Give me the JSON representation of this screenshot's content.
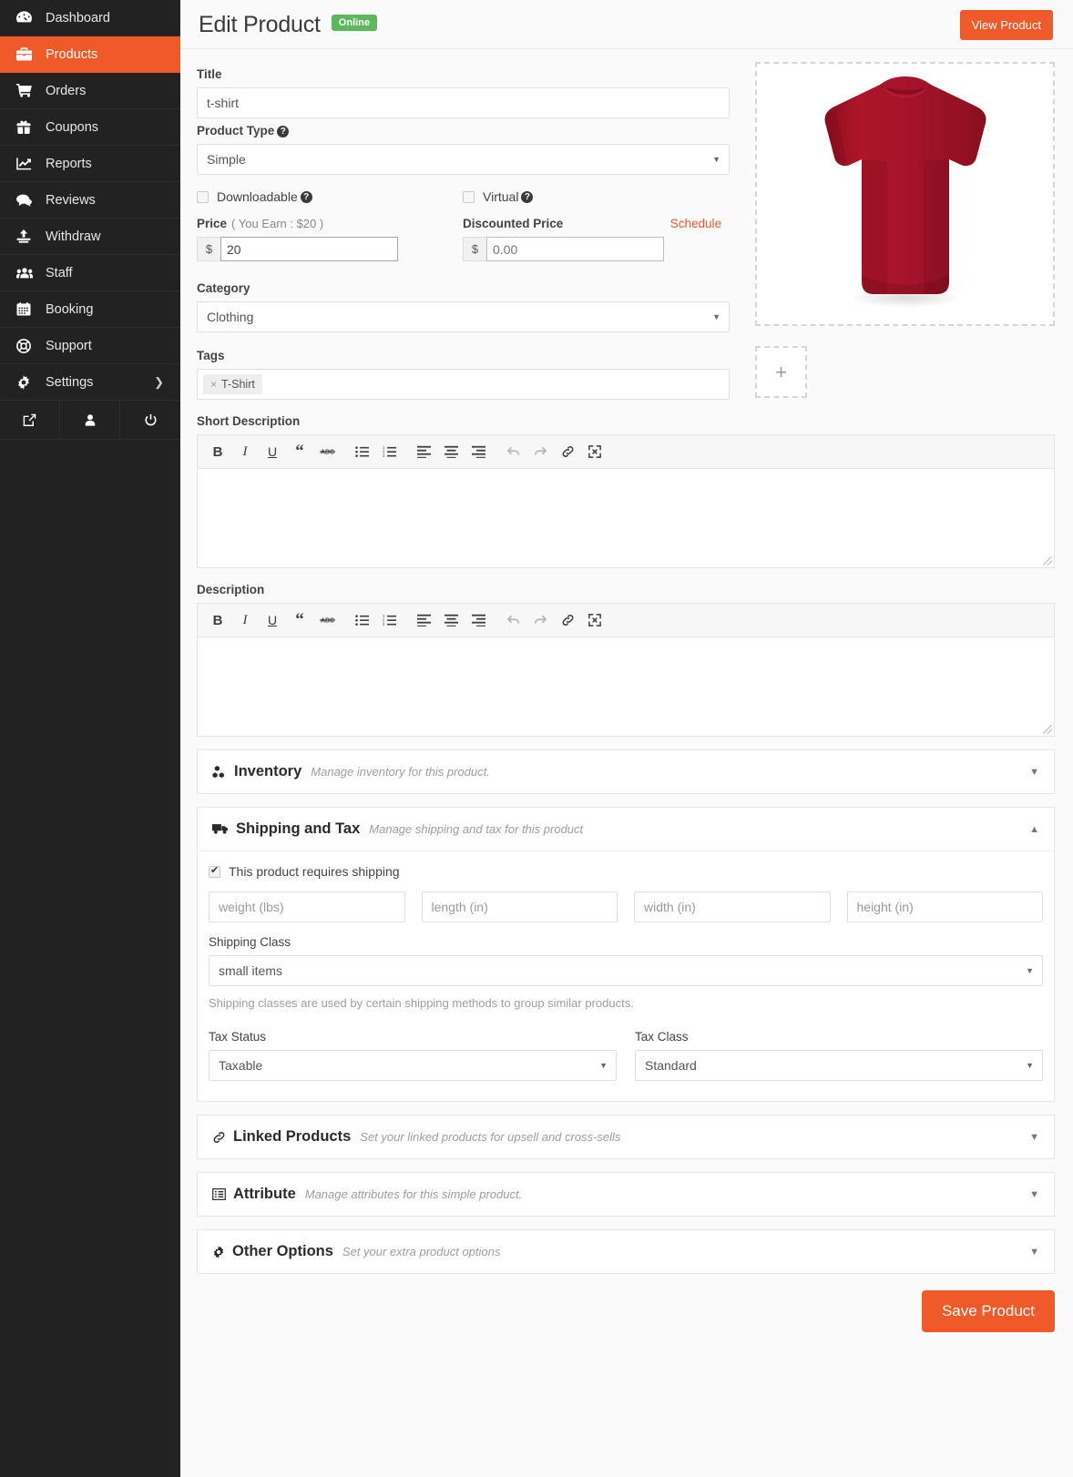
{
  "sidebar": {
    "items": [
      {
        "label": "Dashboard",
        "icon": "dashboard-icon",
        "active": false
      },
      {
        "label": "Products",
        "icon": "products-icon",
        "active": true
      },
      {
        "label": "Orders",
        "icon": "orders-icon",
        "active": false
      },
      {
        "label": "Coupons",
        "icon": "coupons-icon",
        "active": false
      },
      {
        "label": "Reports",
        "icon": "reports-icon",
        "active": false
      },
      {
        "label": "Reviews",
        "icon": "reviews-icon",
        "active": false
      },
      {
        "label": "Withdraw",
        "icon": "withdraw-icon",
        "active": false
      },
      {
        "label": "Staff",
        "icon": "staff-icon",
        "active": false
      },
      {
        "label": "Booking",
        "icon": "booking-icon",
        "active": false
      },
      {
        "label": "Support",
        "icon": "support-icon",
        "active": false
      },
      {
        "label": "Settings",
        "icon": "settings-icon",
        "active": false,
        "has_submenu": true
      }
    ],
    "footer_icons": [
      "external-link-icon",
      "user-icon",
      "power-icon"
    ]
  },
  "header": {
    "title": "Edit Product",
    "status_badge": "Online",
    "view_product_label": "View Product"
  },
  "form": {
    "title_label": "Title",
    "title_value": "t-shirt",
    "product_type_label": "Product Type",
    "product_type_value": "Simple",
    "downloadable_label": "Downloadable",
    "downloadable_checked": false,
    "virtual_label": "Virtual",
    "virtual_checked": false,
    "price_label": "Price",
    "price_earn_note": "( You Earn : $20 )",
    "price_currency": "$",
    "price_value": "20",
    "discounted_label": "Discounted Price",
    "discounted_currency": "$",
    "discounted_placeholder": "0.00",
    "schedule_label": "Schedule",
    "category_label": "Category",
    "category_value": "Clothing",
    "tags_label": "Tags",
    "tags": [
      {
        "remove": "×",
        "label": "T-Shirt"
      }
    ]
  },
  "media": {
    "dropzone_name": "product-image-dropzone",
    "add_image_glyph": "+",
    "image_alt": "red t-shirt product photo"
  },
  "editors": [
    {
      "label": "Short Description",
      "name": "short-description",
      "content": "",
      "toolbar": [
        {
          "name": "bold-icon",
          "glyph": "B"
        },
        {
          "name": "italic-icon",
          "glyph": "I"
        },
        {
          "name": "underline-icon",
          "glyph": "U"
        },
        {
          "name": "blockquote-icon",
          "glyph": "“"
        },
        {
          "name": "strikethrough-icon",
          "glyph": "ABC"
        },
        {
          "name": "bullet-list-icon",
          "glyph": ""
        },
        {
          "name": "numbered-list-icon",
          "glyph": ""
        },
        {
          "name": "align-left-icon",
          "glyph": ""
        },
        {
          "name": "align-center-icon",
          "glyph": ""
        },
        {
          "name": "align-right-icon",
          "glyph": ""
        },
        {
          "name": "undo-icon",
          "glyph": ""
        },
        {
          "name": "redo-icon",
          "glyph": ""
        },
        {
          "name": "link-icon",
          "glyph": ""
        },
        {
          "name": "fullscreen-icon",
          "glyph": ""
        }
      ]
    },
    {
      "label": "Description",
      "name": "description",
      "content": "",
      "toolbar": [
        {
          "name": "bold-icon",
          "glyph": "B"
        },
        {
          "name": "italic-icon",
          "glyph": "I"
        },
        {
          "name": "underline-icon",
          "glyph": "U"
        },
        {
          "name": "blockquote-icon",
          "glyph": "“"
        },
        {
          "name": "strikethrough-icon",
          "glyph": "ABC"
        },
        {
          "name": "bullet-list-icon",
          "glyph": ""
        },
        {
          "name": "numbered-list-icon",
          "glyph": ""
        },
        {
          "name": "align-left-icon",
          "glyph": ""
        },
        {
          "name": "align-center-icon",
          "glyph": ""
        },
        {
          "name": "align-right-icon",
          "glyph": ""
        },
        {
          "name": "undo-icon",
          "glyph": ""
        },
        {
          "name": "redo-icon",
          "glyph": ""
        },
        {
          "name": "link-icon",
          "glyph": ""
        },
        {
          "name": "fullscreen-icon",
          "glyph": ""
        }
      ]
    }
  ],
  "panels": {
    "inventory": {
      "title": "Inventory",
      "subtitle": "Manage inventory for this product.",
      "icon": "cubes-icon",
      "expanded": false,
      "caret": "▼"
    },
    "shipping": {
      "title": "Shipping and Tax",
      "subtitle": "Manage shipping and tax for this product",
      "icon": "truck-icon",
      "expanded": true,
      "caret": "▲",
      "requires_shipping_label": "This product requires shipping",
      "requires_shipping_checked": true,
      "weight_placeholder": "weight (lbs)",
      "length_placeholder": "length (in)",
      "width_placeholder": "width (in)",
      "height_placeholder": "height (in)",
      "shipping_class_label": "Shipping Class",
      "shipping_class_value": "small items",
      "shipping_class_help": "Shipping classes are used by certain shipping methods to group similar products.",
      "tax_status_label": "Tax Status",
      "tax_status_value": "Taxable",
      "tax_class_label": "Tax Class",
      "tax_class_value": "Standard"
    },
    "linked": {
      "title": "Linked Products",
      "subtitle": "Set your linked products for upsell and cross-sells",
      "icon": "link-chain-icon",
      "expanded": false,
      "caret": "▼"
    },
    "attribute": {
      "title": "Attribute",
      "subtitle": "Manage attributes for this simple product.",
      "icon": "list-alt-icon",
      "expanded": false,
      "caret": "▼"
    },
    "other": {
      "title": "Other Options",
      "subtitle": "Set your extra product options",
      "icon": "gear-icon",
      "expanded": false,
      "caret": "▼"
    }
  },
  "footer": {
    "save_label": "Save Product"
  },
  "colors": {
    "accent": "#f05a28",
    "sidebar_bg": "#222222",
    "status_green": "#5cb85c",
    "shirt_red": "#a81228"
  }
}
